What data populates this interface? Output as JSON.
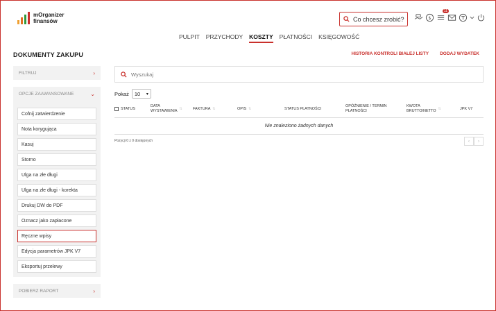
{
  "brand": {
    "name_line1": "mOrganizer",
    "name_line2": "finansów",
    "bar_colors": [
      "#f0a030",
      "#e07020",
      "#2f9a3c",
      "#c9302c"
    ]
  },
  "header": {
    "search_placeholder": "Co chcesz zrobić?",
    "icons": [
      "money-hand-icon",
      "dollar-circle-icon",
      "task-list-icon",
      "mail-icon",
      "user-circle-icon",
      "chevron-down-icon",
      "power-icon"
    ],
    "tasks_badge": "11"
  },
  "nav": {
    "items": [
      {
        "label": "PULPIT",
        "active": false
      },
      {
        "label": "PRZYCHODY",
        "active": false
      },
      {
        "label": "KOSZTY",
        "active": true
      },
      {
        "label": "PŁATNOŚCI",
        "active": false
      },
      {
        "label": "KSIĘGOWOŚĆ",
        "active": false
      }
    ]
  },
  "page": {
    "title": "DOKUMENTY ZAKUPU",
    "actions": [
      "HISTORIA KONTROLI BIAŁEJ LISTY",
      "DODAJ WYDATEK"
    ]
  },
  "sidebar": {
    "filter_label": "FILTRUJ",
    "advanced_label": "OPCJE ZAAWANSOWANE",
    "advanced_items": [
      "Cofnij zatwierdzenie",
      "Nota korygująca",
      "Kasuj",
      "Storno",
      "Ulga na złe długi",
      "Ulga na złe długi - korekta",
      "Drukuj DW do PDF",
      "Oznacz jako zapłacone",
      "Ręczne wpisy",
      "Edycja parametrów JPK V7",
      "Eksportuj przelewy"
    ],
    "selected_item": "Ręczne wpisy",
    "report_label": "POBIERZ RAPORT"
  },
  "table": {
    "search_placeholder": "Wyszukaj",
    "show_label": "Pokaż",
    "show_value": "10",
    "columns": {
      "status": "STATUS",
      "data_1": "DATA",
      "data_2": "WYSTAWIENIA",
      "faktura": "FAKTURA",
      "opis": "OPIS",
      "status_platnosci": "STATUS PŁATNOŚCI",
      "opoznienie_1": "OPÓŹNIENIE / TERMIN",
      "opoznienie_2": "PŁATNOŚCI",
      "kwota_1": "KWOTA",
      "kwota_2": "BRUTTO/NETTO",
      "jpk": "JPK V7"
    },
    "empty_message": "Nie znaleziono żadnych danych",
    "info": "Pozycji 0 z 0 dostępnych",
    "pager_prev": "‹",
    "pager_next": "›"
  },
  "colors": {
    "accent": "#c9302c",
    "panel_bg": "#f2f2f2"
  }
}
